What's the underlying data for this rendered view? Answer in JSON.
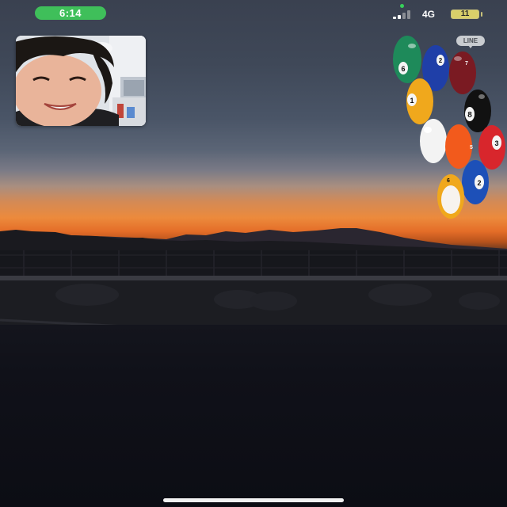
{
  "status_bar": {
    "time": "6:14",
    "network": "4G",
    "battery_level": "11",
    "colors": {
      "time_pill": "#3fbf5a",
      "battery": "#d9cf6a",
      "mic_indicator": "#36d05a"
    }
  },
  "call": {
    "app_badge": "LINE",
    "self_view": "self-camera-preview",
    "background": "sunset-over-mountains-remote-video"
  },
  "sticker": {
    "icon": "billiard-balls-effect",
    "balls": [
      {
        "number": "6",
        "color": "#1e8a5a"
      },
      {
        "number": "2",
        "color": "#1f3fa8"
      },
      {
        "number": "7",
        "color": "#7a1a22"
      },
      {
        "number": "1",
        "color": "#f0a81c"
      },
      {
        "number": "8",
        "color": "#111111"
      },
      {
        "number": "",
        "color": "#f3f3f3"
      },
      {
        "number": "5",
        "color": "#f25a1c"
      },
      {
        "number": "3",
        "color": "#d8262c"
      },
      {
        "number": "2",
        "color": "#1d50b8"
      },
      {
        "number": "6",
        "color": "#f0a81c"
      }
    ]
  },
  "home_indicator": "home-bar"
}
